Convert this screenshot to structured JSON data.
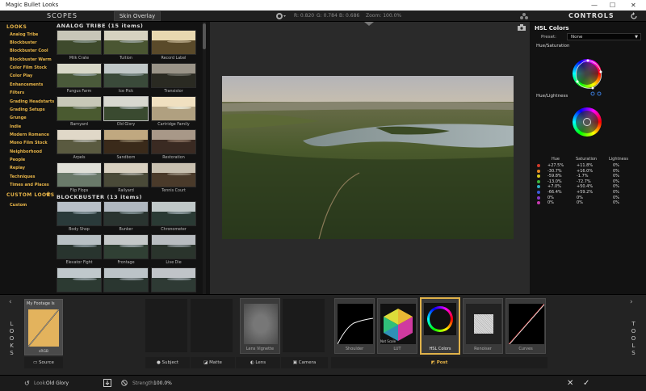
{
  "window": {
    "title": "Magic Bullet Looks",
    "minimize": "—",
    "maximize": "☐",
    "close": "✕"
  },
  "topbar": {
    "scopes_label": "SCOPES",
    "skin_overlay_label": "Skin Overlay",
    "readout": {
      "r": "R: 0.820",
      "g": "G: 0.784",
      "b": "B: 0.686",
      "zoom": "Zoom: 100.0%"
    },
    "controls_label": "CONTROLS"
  },
  "looks": {
    "categories_header": "LOOKS",
    "categories": [
      "Analog Tribe",
      "Blockbuster",
      "Blockbuster Cool",
      "Blockbuster Warm",
      "Color Film Stock",
      "Color Play",
      "Enhancements",
      "Filters",
      "Grading Headstarts",
      "Grading Setups",
      "Grunge",
      "Indie",
      "Modern Romance",
      "Mono Film Stock",
      "Neighborhood",
      "People",
      "Replay",
      "Techniques",
      "Times and Places"
    ],
    "custom_header": "CUSTOM LOOKS",
    "custom_items": [
      "Custom"
    ],
    "sections": [
      {
        "title": "ANALOG TRIBE (15 items)",
        "items": [
          "Milk Crate",
          "Tuition",
          "Record Label",
          "Fungus Farm",
          "Ice Pick",
          "Transistor",
          "Barnyard",
          "Old Glory",
          "Cartridge Family",
          "Arpels",
          "Sandborn",
          "Restoration",
          "Flip Flops",
          "Railyard",
          "Tennis Court"
        ]
      },
      {
        "title": "BLOCKBUSTER (13 items)",
        "items": [
          "Body Shop",
          "Bunker",
          "Chronometer",
          "Elevator Fight",
          "Frontage",
          "Live Die",
          "",
          "",
          ""
        ]
      }
    ]
  },
  "controls": {
    "title": "HSL Colors",
    "preset_label": "Preset:",
    "preset_value": "None",
    "hue_saturation_label": "Hue/Saturation",
    "hue_lightness_label": "Hue/Lightness",
    "table": {
      "headers": [
        "Hue",
        "Saturation",
        "Lightness"
      ],
      "rows": [
        {
          "color": "#d03a2a",
          "hue": "+27.5%",
          "sat": "+11.8%",
          "light": "0%"
        },
        {
          "color": "#e68a22",
          "hue": "-30.7%",
          "sat": "+16.0%",
          "light": "0%"
        },
        {
          "color": "#d8c820",
          "hue": "-59.8%",
          "sat": "-1.7%",
          "light": "0%"
        },
        {
          "color": "#3cb43c",
          "hue": "-13.0%",
          "sat": "-72.7%",
          "light": "0%"
        },
        {
          "color": "#30b0c8",
          "hue": "+7.0%",
          "sat": "+50.4%",
          "light": "0%"
        },
        {
          "color": "#3a5ad8",
          "hue": "-66.4%",
          "sat": "+59.2%",
          "light": "0%"
        },
        {
          "color": "#8a3ac8",
          "hue": "0%",
          "sat": "0%",
          "light": "0%"
        },
        {
          "color": "#c83ab0",
          "hue": "0%",
          "sat": "0%",
          "light": "0%"
        }
      ]
    }
  },
  "bottom": {
    "looks_vertical": "LOOKS",
    "tools_vertical": "TOOLS",
    "source_tile": {
      "name": "My Footage Is",
      "label": "sRGB"
    },
    "tools": [
      {
        "name": "Lens Vignette"
      },
      {
        "name": "Shoulder"
      },
      {
        "name": "LUT",
        "sub": "Not Scale"
      },
      {
        "name": "HSL Colors"
      },
      {
        "name": "Renoiser"
      },
      {
        "name": "Curves"
      }
    ],
    "categories": [
      "Source",
      "Subject",
      "Matte",
      "Lens",
      "Camera",
      "Post"
    ]
  },
  "status": {
    "look_label": "Look:",
    "look_value": "Old Glory",
    "strength_label": "Strength:",
    "strength_value": "100.0%"
  }
}
